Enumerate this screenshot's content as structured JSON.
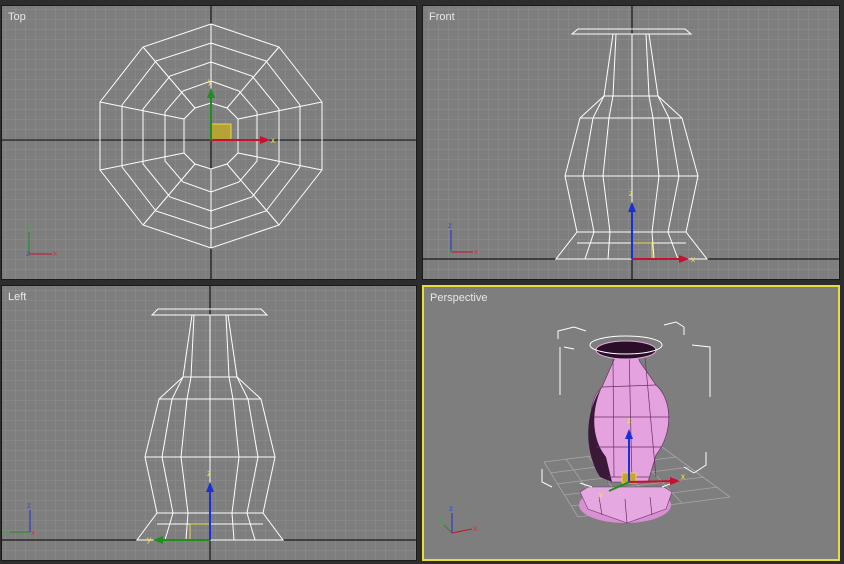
{
  "viewports": {
    "top": {
      "label": "Top"
    },
    "front": {
      "label": "Front"
    },
    "left": {
      "label": "Left"
    },
    "perspective": {
      "label": "Perspective",
      "active": true
    }
  },
  "axis_labels": {
    "x": "x",
    "y": "y",
    "z": "z"
  },
  "colors": {
    "viewport_bg": "#7e7e7e",
    "grid_minor": "#8c8c8c",
    "grid_major": "#000000",
    "wire": "#ffffff",
    "active_border": "#e6de3c",
    "axis_x": "#c8102e",
    "axis_y": "#1e8f1e",
    "axis_z": "#1a2fd8",
    "shaded_mesh": "#e6a0df"
  }
}
